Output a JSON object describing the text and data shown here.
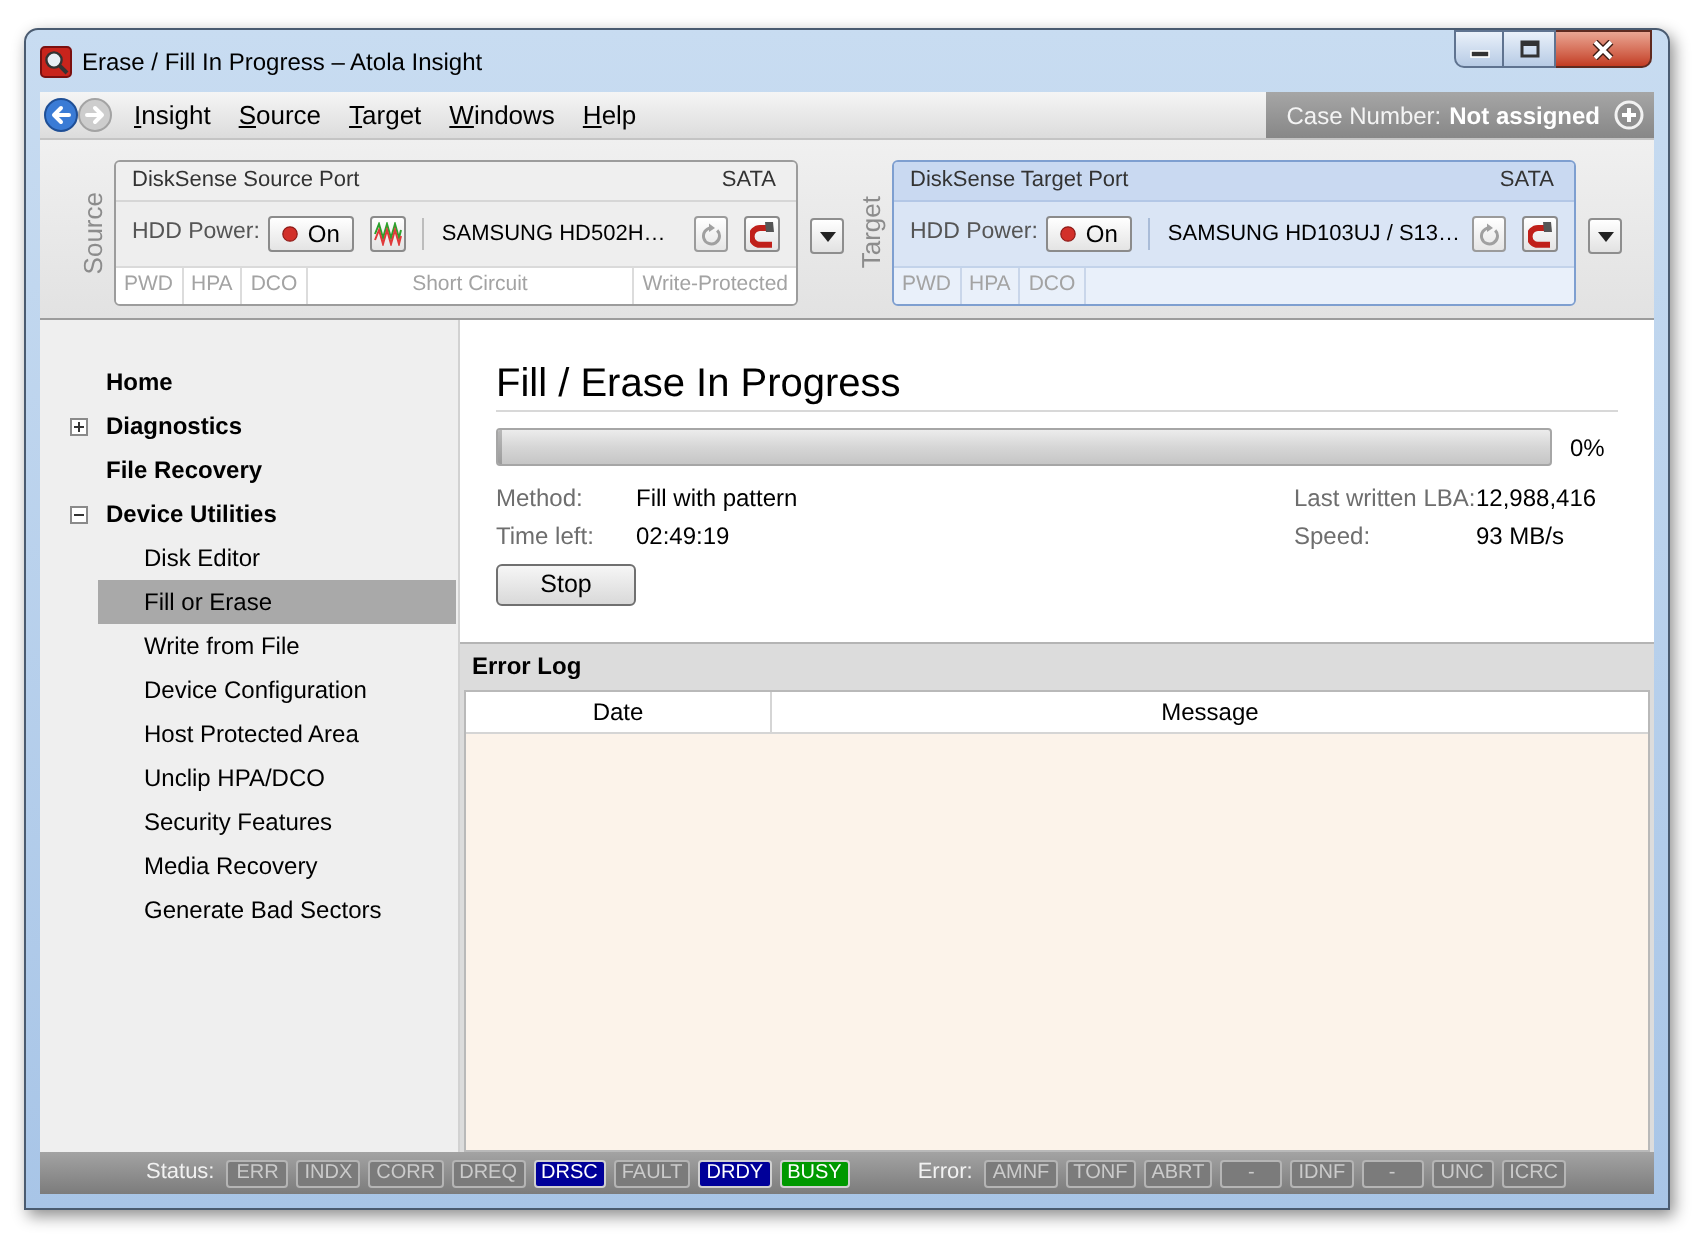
{
  "window": {
    "title": "Erase / Fill In Progress – Atola Insight"
  },
  "navigation": [
    {
      "kind": "back",
      "disabled": false
    },
    {
      "kind": "forward",
      "disabled": true
    }
  ],
  "menu": [
    "Insight",
    "Source",
    "Target",
    "Windows",
    "Help"
  ],
  "case_number": {
    "label": "Case Number:",
    "value": "Not assigned"
  },
  "ports": [
    {
      "side_label": "Source",
      "title": "DiskSense Source Port",
      "interface": "SATA",
      "active": false,
      "power_label": "HDD Power:",
      "power_button": "On",
      "power_on": true,
      "signal_monitor": true,
      "device": "SAMSUNG HD502H…",
      "flags": [
        "PWD",
        "HPA",
        "DCO"
      ],
      "alerts": [
        "Short Circuit",
        "Write-Protected"
      ]
    },
    {
      "side_label": "Target",
      "title": "DiskSense Target Port",
      "interface": "SATA",
      "active": true,
      "power_label": "HDD Power:",
      "power_button": "On",
      "power_on": true,
      "device": "SAMSUNG HD103UJ / S13…",
      "flags": [
        "PWD",
        "HPA",
        "DCO"
      ]
    }
  ],
  "sidebar": {
    "items": [
      {
        "label": "Home",
        "selected": false
      },
      {
        "label": "Diagnostics",
        "selected": false,
        "expanded": false
      },
      {
        "label": "File Recovery",
        "selected": false
      },
      {
        "label": "Device Utilities",
        "selected": false,
        "expanded": true,
        "children": [
          {
            "label": "Disk Editor",
            "selected": false
          },
          {
            "label": "Fill or Erase",
            "selected": true
          },
          {
            "label": "Write from File",
            "selected": false
          },
          {
            "label": "Device Configuration",
            "selected": false
          },
          {
            "label": "Host Protected Area",
            "selected": false
          },
          {
            "label": "Unclip HPA/DCO",
            "selected": false
          },
          {
            "label": "Security Features",
            "selected": false
          },
          {
            "label": "Media Recovery",
            "selected": false
          },
          {
            "label": "Generate Bad Sectors",
            "selected": false
          }
        ]
      }
    ]
  },
  "heading": "Fill / Erase In Progress",
  "progress": {
    "level": 0,
    "reading": "0%"
  },
  "details": {
    "left": [
      {
        "label": "Method:",
        "value": "Fill with pattern"
      },
      {
        "label": "Time left:",
        "value": "02:49:19"
      }
    ],
    "right": [
      {
        "label": "Last written LBA:",
        "value": "12,988,416"
      },
      {
        "label": "Speed:",
        "value": "93 MB/s"
      }
    ]
  },
  "stop_button": "Stop",
  "error_log": {
    "title": "Error Log",
    "columns": [
      "Date",
      "Message"
    ]
  },
  "status_bar": {
    "status_label": "Status:",
    "status_flags": [
      {
        "label": "ERR",
        "on": false
      },
      {
        "label": "INDX",
        "on": false
      },
      {
        "label": "CORR",
        "on": false
      },
      {
        "label": "DREQ",
        "on": false
      },
      {
        "label": "DRSC",
        "on": true,
        "color": "#000099"
      },
      {
        "label": "FAULT",
        "on": false
      },
      {
        "label": "DRDY",
        "on": true,
        "color": "#000099"
      },
      {
        "label": "BUSY",
        "on": true,
        "color": "#009900"
      }
    ],
    "error_label": "Error:",
    "error_flags": [
      {
        "label": "AMNF",
        "on": false
      },
      {
        "label": "TONF",
        "on": false
      },
      {
        "label": "ABRT",
        "on": false
      },
      {
        "label": "-",
        "on": false
      },
      {
        "label": "IDNF",
        "on": false
      },
      {
        "label": "-",
        "on": false
      },
      {
        "label": "UNC",
        "on": false
      },
      {
        "label": "ICRC",
        "on": false
      }
    ]
  }
}
